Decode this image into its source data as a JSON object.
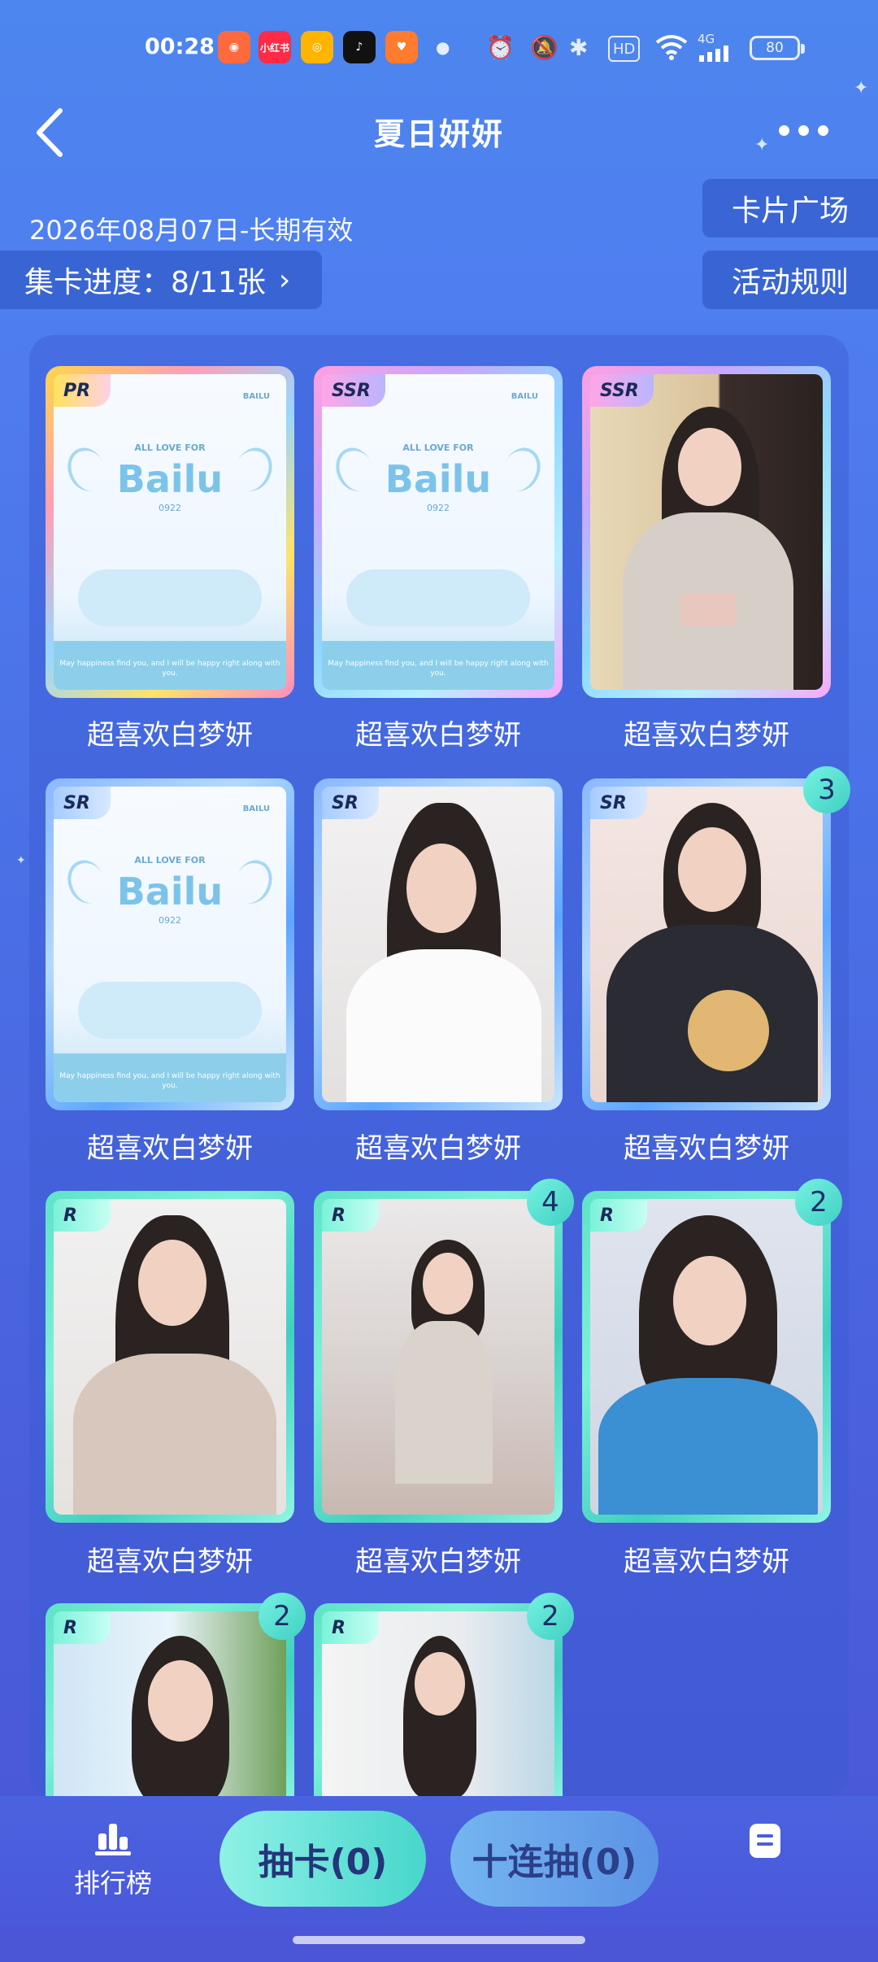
{
  "status_bar": {
    "time": "00:28",
    "apps": [
      "小红书"
    ],
    "network": "4G",
    "battery": "80"
  },
  "header": {
    "title": "夏日妍妍",
    "back_icon": "chevron-left-icon",
    "more_icon": "more-horizontal-icon"
  },
  "validity": "2026年08月07日-长期有效",
  "progress": {
    "label": "集卡进度：8/11张",
    "chevron": "›"
  },
  "side_buttons": {
    "card_square": "卡片广场",
    "rules": "活动规则"
  },
  "cards": [
    {
      "rarity": "PR",
      "name": "超喜欢白梦妍",
      "count": "",
      "art": "cover"
    },
    {
      "rarity": "SSR",
      "name": "超喜欢白梦妍",
      "count": "",
      "art": "cover"
    },
    {
      "rarity": "SSR",
      "name": "超喜欢白梦妍",
      "count": "",
      "art": "photo"
    },
    {
      "rarity": "SR",
      "name": "超喜欢白梦妍",
      "count": "",
      "art": "cover"
    },
    {
      "rarity": "SR",
      "name": "超喜欢白梦妍",
      "count": "",
      "art": "photo"
    },
    {
      "rarity": "SR",
      "name": "超喜欢白梦妍",
      "count": "3",
      "art": "photo"
    },
    {
      "rarity": "R",
      "name": "超喜欢白梦妍",
      "count": "",
      "art": "photo"
    },
    {
      "rarity": "R",
      "name": "超喜欢白梦妍",
      "count": "4",
      "art": "photo"
    },
    {
      "rarity": "R",
      "name": "超喜欢白梦妍",
      "count": "2",
      "art": "photo"
    },
    {
      "rarity": "R",
      "name": "",
      "count": "2",
      "art": "photo"
    },
    {
      "rarity": "R",
      "name": "",
      "count": "2",
      "art": "photo"
    }
  ],
  "cover_art": {
    "brand": "Bailu",
    "top_line": "ALL LOVE FOR",
    "number": "0922",
    "corner": "BAILU",
    "footer": "May happiness find you, and I will be happy right along with you."
  },
  "bottom_bar": {
    "rank_label": "排行榜",
    "draw_one": "抽卡(0)",
    "draw_ten": "十连抽(0)"
  },
  "colors": {
    "background_top": "#4d86ee",
    "background_bottom": "#4a56d6",
    "draw_one_button": "#48d6cc",
    "draw_ten_button": "#5c93e6"
  }
}
